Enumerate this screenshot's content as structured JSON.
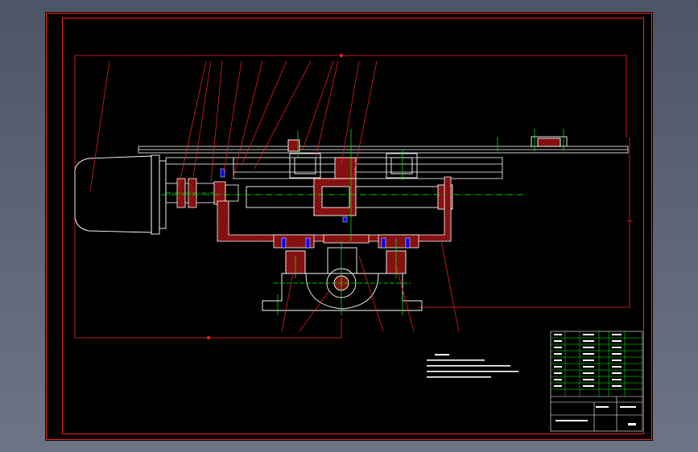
{
  "colors": {
    "background": "#5a6474",
    "paper": "#000000",
    "frame": "#ff0000",
    "outline": "#ffffff",
    "section_hatch": "#c81e1e",
    "centerline": "#00ff00",
    "bolt": "#0000ff",
    "table_line": "#00ff00"
  }
}
